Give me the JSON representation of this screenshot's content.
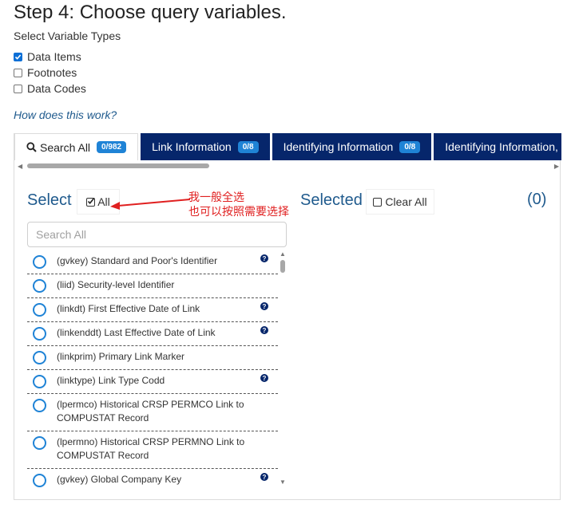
{
  "page": {
    "title": "Step 4: Choose query variables."
  },
  "variable_types": {
    "heading": "Select Variable Types",
    "options": [
      {
        "label": "Data Items",
        "checked": true
      },
      {
        "label": "Footnotes",
        "checked": false
      },
      {
        "label": "Data Codes",
        "checked": false
      }
    ],
    "help_link": "How does this work?"
  },
  "tabs": [
    {
      "label": "Search All",
      "badge": "0/982",
      "active": true,
      "icon": "search-icon"
    },
    {
      "label": "Link Information",
      "badge": "0/8",
      "active": false
    },
    {
      "label": "Identifying Information",
      "badge": "0/8",
      "active": false
    },
    {
      "label": "Identifying Information, co",
      "badge": "",
      "active": false
    }
  ],
  "select_panel": {
    "select_label": "Select",
    "all_label": "All",
    "selected_label": "Selected",
    "clear_all_label": "Clear All",
    "selected_count": "(0)",
    "search_placeholder": "Search All"
  },
  "annotation": {
    "line1": "我一般全选",
    "line2": "也可以按照需要选择",
    "color": "#e02020"
  },
  "variables": [
    {
      "label": "(gvkey) Standard and Poor's Identifier",
      "help": true
    },
    {
      "label": "(liid) Security-level Identifier",
      "help": false
    },
    {
      "label": "(linkdt) First Effective Date of Link",
      "help": true
    },
    {
      "label": "(linkenddt) Last Effective Date of Link",
      "help": true
    },
    {
      "label": "(linkprim) Primary Link Marker",
      "help": false
    },
    {
      "label": "(linktype) Link Type Codd",
      "help": true
    },
    {
      "label": "(lpermco) Historical CRSP PERMCO Link to COMPUSTAT Record",
      "help": false
    },
    {
      "label": "(lpermno) Historical CRSP PERMNO Link to COMPUSTAT Record",
      "help": false
    },
    {
      "label": "(gvkey) Global Company Key",
      "help": true
    }
  ],
  "colors": {
    "tab_bg": "#06266b",
    "badge_bg": "#1f83d6",
    "heading_blue": "#1f5a8d",
    "radio_blue": "#1f83d6"
  }
}
